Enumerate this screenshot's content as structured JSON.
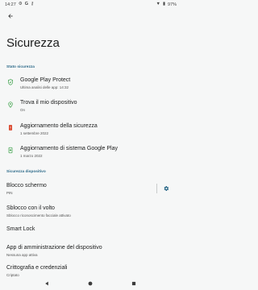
{
  "status_bar": {
    "time": "14:27",
    "left_icons": [
      "gear-icon",
      "google-icon",
      "vpn-key-icon"
    ],
    "battery": "97%"
  },
  "header": {
    "back_icon": "arrow-back-icon",
    "title": "Sicurezza"
  },
  "sections": [
    {
      "label": "Stato sicurezza",
      "items": [
        {
          "title": "Google Play Protect",
          "subtitle": "Ultima analisi delle app: 14:32",
          "icon": "shield-check-icon",
          "icon_color": "#2e9a3c"
        },
        {
          "title": "Trova il mio dispositivo",
          "subtitle": "On",
          "icon": "location-pin-icon",
          "icon_color": "#2e9a3c"
        },
        {
          "title": "Aggiornamento della sicurezza",
          "subtitle": "1 settembre 2022",
          "icon": "phone-alert-icon",
          "icon_color": "#d9452b"
        },
        {
          "title": "Aggiornamento di sistema Google Play",
          "subtitle": "1 marzo 2022",
          "icon": "phone-update-icon",
          "icon_color": "#2e9a3c"
        }
      ]
    },
    {
      "label": "Sicurezza dispositivo",
      "items": [
        {
          "title": "Blocco schermo",
          "subtitle": "PIN",
          "settings_icon": "gear-icon"
        },
        {
          "title": "Sblocco con il volto",
          "subtitle": "Sblocco riconoscimento facciale attivato"
        },
        {
          "title": "Smart Lock",
          "subtitle": ""
        },
        {
          "title": "App di amministrazione del dispositivo",
          "subtitle": "Nessuna app attiva"
        },
        {
          "title": "Crittografia e credenziali",
          "subtitle": "Criptato"
        }
      ]
    }
  ],
  "nav_bar": {
    "back_icon": "nav-back-icon",
    "home_icon": "nav-home-icon",
    "recents_icon": "nav-recents-icon"
  },
  "colors": {
    "accent": "#2e6b8a",
    "ok_green": "#2e9a3c",
    "alert_red": "#d9452b",
    "background": "#f6f7f7"
  }
}
